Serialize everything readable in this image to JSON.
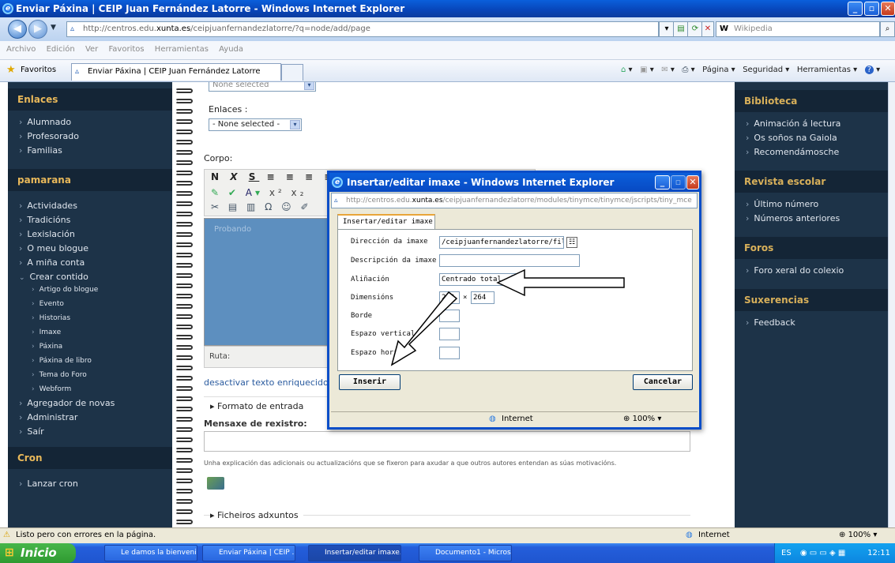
{
  "window": {
    "title": "Enviar Páxina | CEIP Juan Fernández Latorre - Windows Internet Explorer"
  },
  "addressbar": {
    "url_prefix": "http://centros.edu.",
    "url_domain": "xunta.es",
    "url_suffix": "/ceipjuanfernandezlatorre/?q=node/add/page",
    "search_placeholder": "Wikipedia"
  },
  "menu": [
    "Archivo",
    "Edición",
    "Ver",
    "Favoritos",
    "Herramientas",
    "Ayuda"
  ],
  "favbar": {
    "favorites": "Favoritos",
    "tab_title": "Enviar Páxina | CEIP Juan Fernández Latorre",
    "pagina": "Página",
    "seguridad": "Seguridad",
    "herramientas": "Herramientas"
  },
  "left_sidebar": {
    "enlaces_title": "Enlaces",
    "enlaces": [
      "Alumnado",
      "Profesorado",
      "Familias"
    ],
    "user_title": "pamarana",
    "user_items": [
      "Actividades",
      "Tradicións",
      "Lexislación",
      "O meu blogue",
      "A miña conta",
      "Crear contido"
    ],
    "crear_sub": [
      "Artigo do blogue",
      "Evento",
      "Historias",
      "Imaxe",
      "Páxina",
      "Páxina de libro",
      "Tema do Foro",
      "Webform"
    ],
    "more_items": [
      "Agregador de novas",
      "Administrar",
      "Saír"
    ],
    "cron_title": "Cron",
    "cron_items": [
      "Lanzar cron"
    ]
  },
  "right_sidebar": {
    "biblioteca_title": "Biblioteca",
    "biblioteca": [
      "Animación á lectura",
      "Os soños na Gaiola",
      "Recomendámosche"
    ],
    "revista_title": "Revista escolar",
    "revista": [
      "Último número",
      "Números anteriores"
    ],
    "foros_title": "Foros",
    "foros": [
      "Foro xeral do colexio"
    ],
    "sux_title": "Suxerencias",
    "sux": [
      "Feedback"
    ]
  },
  "form": {
    "none_selected_top": "None selected",
    "enlaces_label": "Enlaces :",
    "enlaces_value": "- None selected -",
    "corpo_label": "Corpo:",
    "editor_text": "Probando",
    "ruta": "Ruta:",
    "toggle_link": "desactivar texto enriquecido",
    "formato": "Formato de entrada",
    "mensaxe_label": "Mensaxe de rexistro:",
    "explanation": "Unha explicación das adicionais ou actualizacións que se fixeron para axudar a que outros autores entendan as súas motivacións.",
    "ficheiros": "Ficheiros adxuntos"
  },
  "dialog": {
    "title": "Insertar/editar imaxe - Windows Internet Explorer",
    "url_prefix": "http://centros.edu.",
    "url_domain": "xunta.es",
    "url_suffix": "/ceipjuanfernandezlatorre/modules/tinymce/tinymce/jscripts/tiny_mce",
    "tab": "Insertar/editar imaxe",
    "fields": {
      "direccion_label": "Dirección da imaxe",
      "direccion_value": "/ceipjuanfernandezlatorre/files/",
      "descripcion_label": "Descripción da imaxe",
      "alineacion_label": "Aliñación",
      "alineacion_value": "Centrado total",
      "dimensions_label": "Dimensións",
      "width": "280",
      "height": "264",
      "borde_label": "Borde",
      "vertical_label": "Espazo vertical",
      "horizontal_label": "Espazo hori"
    },
    "insert_button": "Inserir",
    "cancel_button": "Cancelar",
    "status_zone": "Internet",
    "zoom": "100%"
  },
  "statusbar": {
    "message": "Listo pero con errores en la página.",
    "zone": "Internet",
    "zoom": "100%"
  },
  "taskbar": {
    "start": "Inicio",
    "tasks": [
      "Le damos la bienveni...",
      "Enviar Páxina | CEIP ...",
      "Insertar/editar imaxe...",
      "Documento1 - Micros..."
    ],
    "lang": "ES",
    "clock": "12:11"
  },
  "colors": {
    "sidebar": "#1d3348",
    "sidebar_header": "#e8b85a",
    "xp_blue": "#0a5fdb",
    "editor": "#5d8fbf"
  }
}
